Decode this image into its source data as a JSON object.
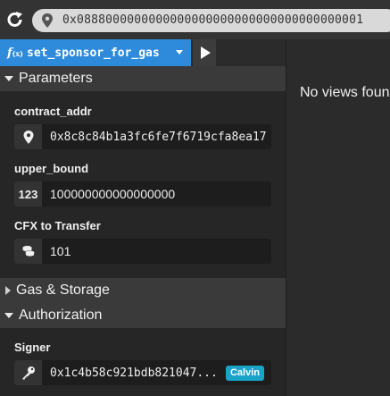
{
  "topbar": {
    "contract_address": "0x0888000000000000000000000000000000000001"
  },
  "function": {
    "fx_symbol": "f",
    "fx_sub": "(x)",
    "name": "set_sponsor_for_gas"
  },
  "sections": {
    "parameters": "Parameters",
    "gas_storage": "Gas & Storage",
    "authorization": "Authorization"
  },
  "params": {
    "contract_addr": {
      "label": "contract_addr",
      "value": "0x8c8c84b1a3fc6fe7f6719cfa8ea17"
    },
    "upper_bound": {
      "label": "upper_bound",
      "type_badge": "123",
      "value": "100000000000000000"
    },
    "cfx_transfer": {
      "label": "CFX to Transfer",
      "value": "101"
    }
  },
  "signer": {
    "label": "Signer",
    "value": "0x1c4b58c921bdb821047...",
    "badge": "Calvin"
  },
  "views": {
    "empty_text": "No views found"
  },
  "colors": {
    "accent": "#2e8bdc",
    "badge": "#1aa3c8",
    "panel": "#262626",
    "section_header": "#3a3a3a"
  }
}
